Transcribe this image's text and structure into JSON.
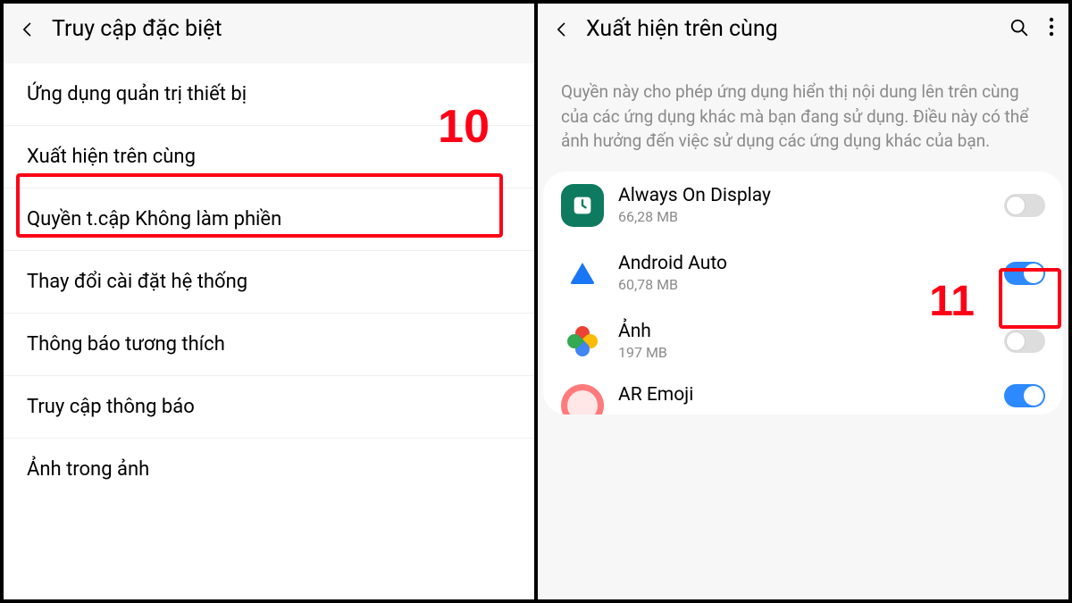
{
  "left": {
    "title": "Truy cập đặc biệt",
    "items": [
      "Ứng dụng quản trị thiết bị",
      "Xuất hiện trên cùng",
      "Quyền t.cập Không làm phiền",
      "Thay đổi cài đặt hệ thống",
      "Thông báo tương thích",
      "Truy cập thông báo",
      "Ảnh trong ảnh"
    ],
    "step_label": "10"
  },
  "right": {
    "title": "Xuất hiện trên cùng",
    "description": "Quyền này cho phép ứng dụng hiển thị nội dung lên trên cùng của các ứng dụng khác mà bạn đang sử dụng. Điều này có thể ảnh hưởng đến việc sử dụng các ứng dụng khác của bạn.",
    "step_label": "11",
    "apps": [
      {
        "name": "Always On Display",
        "sub": "66,28 MB",
        "on": false
      },
      {
        "name": "Android Auto",
        "sub": "60,78 MB",
        "on": true
      },
      {
        "name": "Ảnh",
        "sub": "197 MB",
        "on": false
      },
      {
        "name": "AR Emoji",
        "sub": "",
        "on": true
      }
    ]
  }
}
